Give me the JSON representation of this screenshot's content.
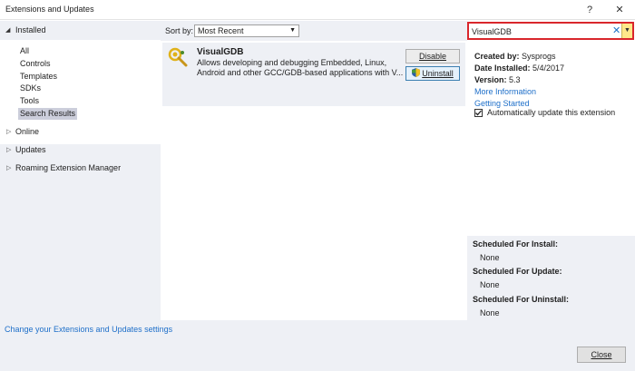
{
  "window": {
    "title": "Extensions and Updates",
    "help_label": "?",
    "close_label": "✕"
  },
  "sidebar": {
    "installed_label": "Installed",
    "installed_items": [
      {
        "label": "All"
      },
      {
        "label": "Controls"
      },
      {
        "label": "Templates"
      },
      {
        "label": "SDKs"
      },
      {
        "label": "Tools"
      },
      {
        "label": "Search Results",
        "selected": true
      }
    ],
    "groups": [
      {
        "label": "Online"
      },
      {
        "label": "Updates"
      },
      {
        "label": "Roaming Extension Manager"
      }
    ]
  },
  "sort": {
    "label": "Sort by:",
    "value": "Most Recent"
  },
  "extension": {
    "name": "VisualGDB",
    "description": "Allows developing and debugging Embedded, Linux, Android and other GCC/GDB-based applications with V...",
    "disable_label": "Disable",
    "uninstall_label": "Uninstall"
  },
  "search": {
    "value": "VisualGDB"
  },
  "details": {
    "created_by_label": "Created by:",
    "created_by": "Sysprogs",
    "date_installed_label": "Date Installed:",
    "date_installed": "5/4/2017",
    "version_label": "Version:",
    "version": "5.3",
    "more_info_label": "More Information",
    "getting_started_label": "Getting Started",
    "auto_update_label": "Automatically update this extension",
    "auto_update_checked": true
  },
  "scheduled": {
    "install_label": "Scheduled For Install:",
    "install_value": "None",
    "update_label": "Scheduled For Update:",
    "update_value": "None",
    "uninstall_label": "Scheduled For Uninstall:",
    "uninstall_value": "None"
  },
  "footer": {
    "settings_link": "Change your Extensions and Updates settings",
    "close_button": "Close"
  },
  "colors": {
    "panel_bg": "#eef0f5",
    "link": "#1e6fc9",
    "search_border": "#d9262c",
    "selected_bg": "#cccedb"
  }
}
